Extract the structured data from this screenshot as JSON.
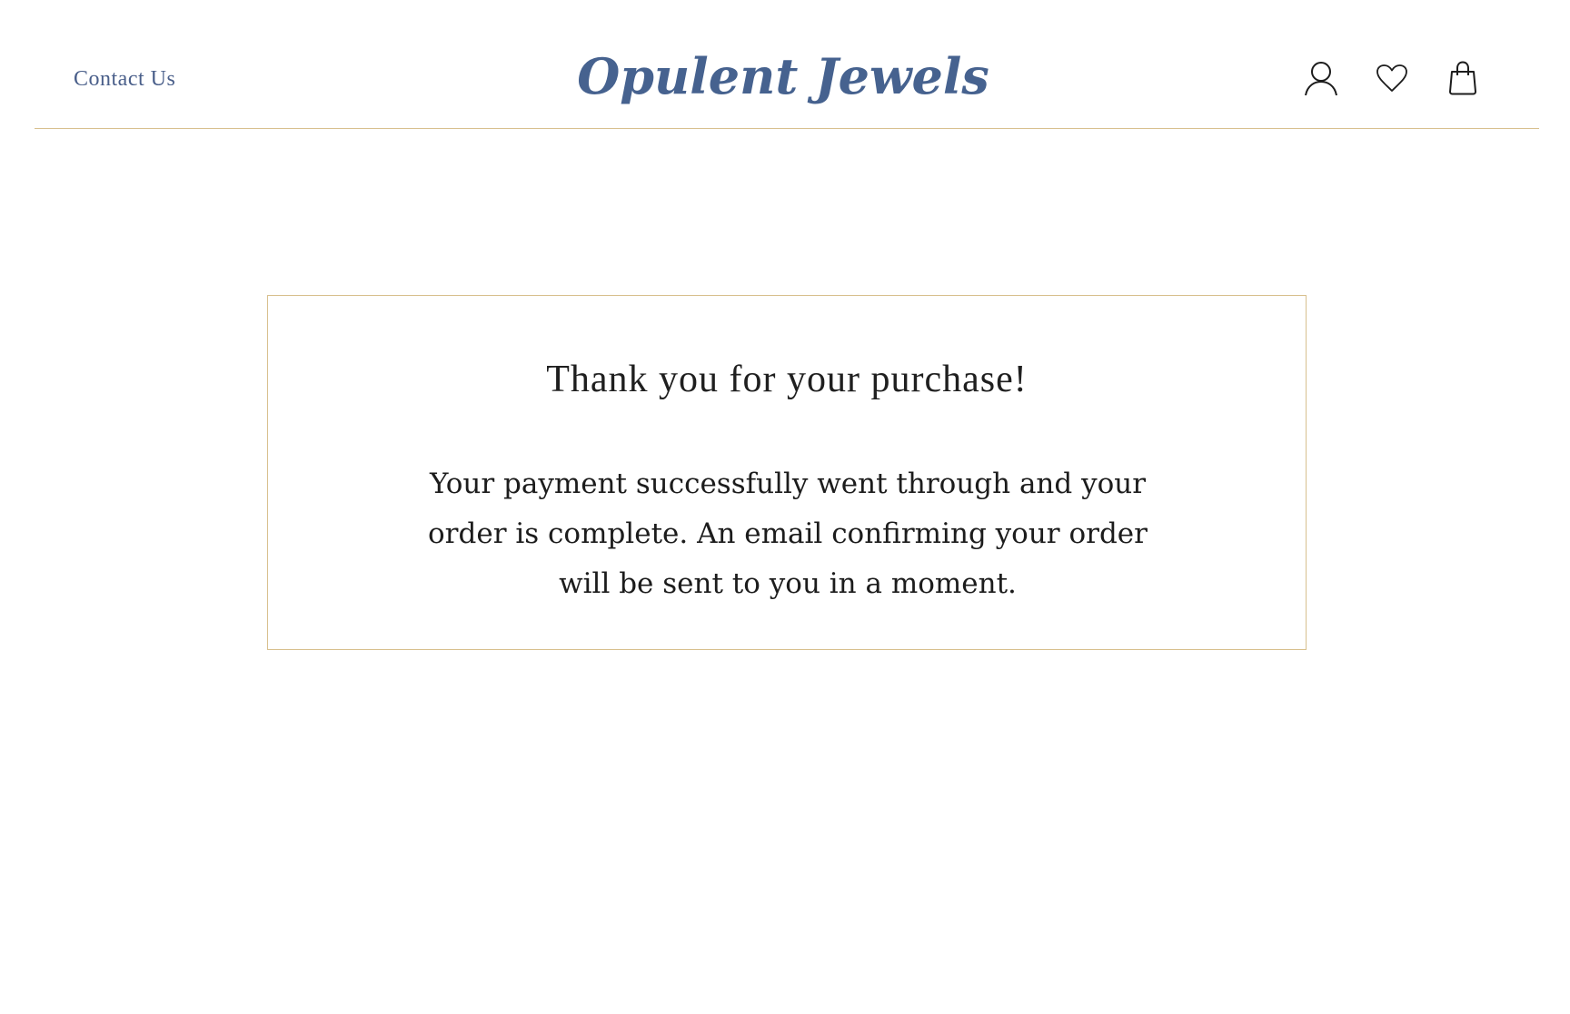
{
  "header": {
    "contact_label": "Contact Us",
    "brand_name": "Opulent Jewels",
    "icons": {
      "account": "user-icon",
      "wishlist": "heart-icon",
      "cart": "shopping-bag-icon"
    }
  },
  "confirmation": {
    "title": "Thank you for your purchase!",
    "message": "Your payment successfully went through and your order is complete. An email confirming your order will be sent to you in a moment."
  },
  "colors": {
    "brand_blue": "#46628f",
    "gold_border": "#d8c08e",
    "text_dark": "#1c1c1c"
  }
}
